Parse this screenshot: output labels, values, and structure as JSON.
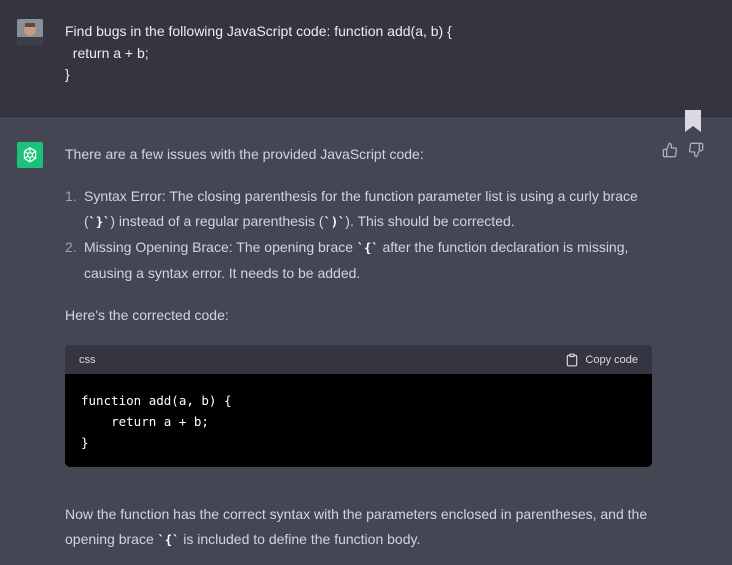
{
  "user_message": {
    "line1": "Find bugs in the following JavaScript code: function add(a, b) {",
    "line2": "  return a + b;",
    "line3": "}"
  },
  "assistant": {
    "intro": "There are a few issues with the provided JavaScript code:",
    "items": [
      {
        "num": "1.",
        "a": "Syntax Error: The closing parenthesis for the function parameter list is using a curly brace (",
        "code1": "`}`",
        "b": ") instead of a regular parenthesis (",
        "code2": "`)`",
        "c": "). This should be corrected."
      },
      {
        "num": "2.",
        "a": "Missing Opening Brace: The opening brace ",
        "code1": "`{`",
        "b": " after the function declaration is missing, causing a syntax error. It needs to be added."
      }
    ],
    "corrected_intro": "Here's the corrected code:",
    "code_block": {
      "language": "css",
      "copy_label": "Copy code",
      "code": "function add(a, b) {\n    return a + b;\n}"
    },
    "outro_a": "Now the function has the correct syntax with the parameters enclosed in parentheses, and the opening brace ",
    "outro_code": "`{`",
    "outro_b": " is included to define the function body."
  },
  "colors": {
    "user_bg": "#343541",
    "assistant_bg": "#444654",
    "bot_avatar": "#19c37d"
  }
}
